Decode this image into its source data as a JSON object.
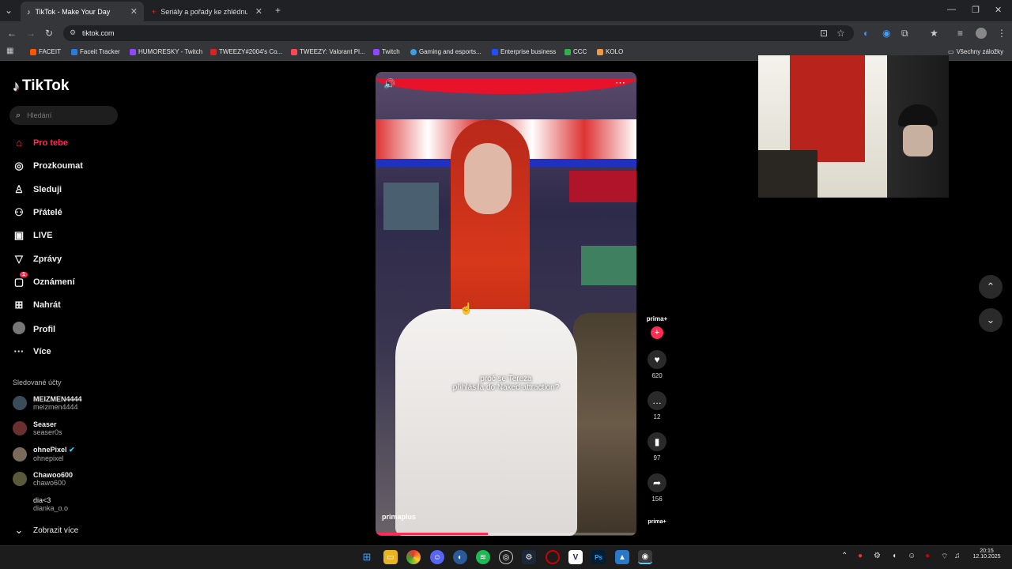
{
  "browser": {
    "tabs": [
      {
        "label": "TikTok - Make Your Day"
      },
      {
        "label": "Seriály a pořady ke zhlédnutí or"
      }
    ],
    "url": "tiktok.com",
    "bookmarks": [
      {
        "label": "FACEIT",
        "color": "#ff5500"
      },
      {
        "label": "Faceit Tracker",
        "color": "#2a7bde"
      },
      {
        "label": "HUMORESKY - Twitch",
        "color": "#9146ff"
      },
      {
        "label": "TWEEZY#2004's Co...",
        "color": "#d22"
      },
      {
        "label": "TWEEZY: Valorant Pl...",
        "color": "#ff4655"
      },
      {
        "label": "Twitch",
        "color": "#9146ff"
      },
      {
        "label": "Gaming and esports...",
        "color": "#3ba0e6"
      },
      {
        "label": "Enterprise business",
        "color": "#1f4fff"
      },
      {
        "label": "CCC",
        "color": "#2bb34a"
      },
      {
        "label": "KOLO",
        "color": "#e94"
      }
    ],
    "all_bookmarks": "Všechny záložky"
  },
  "sidebar": {
    "logo": "TikTok",
    "search_placeholder": "Hledání",
    "nav": [
      {
        "label": "Pro tebe",
        "icon": "home-icon"
      },
      {
        "label": "Prozkoumat",
        "icon": "compass-icon"
      },
      {
        "label": "Sleduji",
        "icon": "following-icon"
      },
      {
        "label": "Přátelé",
        "icon": "friends-icon"
      },
      {
        "label": "LIVE",
        "icon": "live-icon"
      },
      {
        "label": "Zprávy",
        "icon": "messages-icon"
      },
      {
        "label": "Oznámení",
        "icon": "inbox-icon",
        "badge": "1"
      },
      {
        "label": "Nahrát",
        "icon": "upload-icon"
      },
      {
        "label": "Profil",
        "icon": "profile-icon"
      },
      {
        "label": "Více",
        "icon": "more-icon"
      }
    ],
    "followed_title": "Sledované účty",
    "accounts": [
      {
        "name": "MEIZMEN4444",
        "handle": "meizmen4444"
      },
      {
        "name": "Seaser",
        "handle": "seaser0s"
      },
      {
        "name": "ohnePixel",
        "handle": "ohnepixel"
      },
      {
        "name": "Chawoo600",
        "handle": "chawo600"
      },
      {
        "name": "dia<3",
        "handle": "dianka_o.o"
      }
    ],
    "show_more": "Zobrazit více"
  },
  "video": {
    "caption_line1": "proč se Tereza",
    "caption_line2": "přihlásila do Naked attraction?",
    "watermark": "primaplus",
    "progress": 0.43
  },
  "actions": {
    "creator": "prima+",
    "likes": "620",
    "comments": "12",
    "saves": "97",
    "shares": "156",
    "music": "prima+"
  },
  "taskbar": {
    "time": "20:15",
    "date": "12.10.2025"
  },
  "colors": {
    "accent": "#fe2c55"
  }
}
